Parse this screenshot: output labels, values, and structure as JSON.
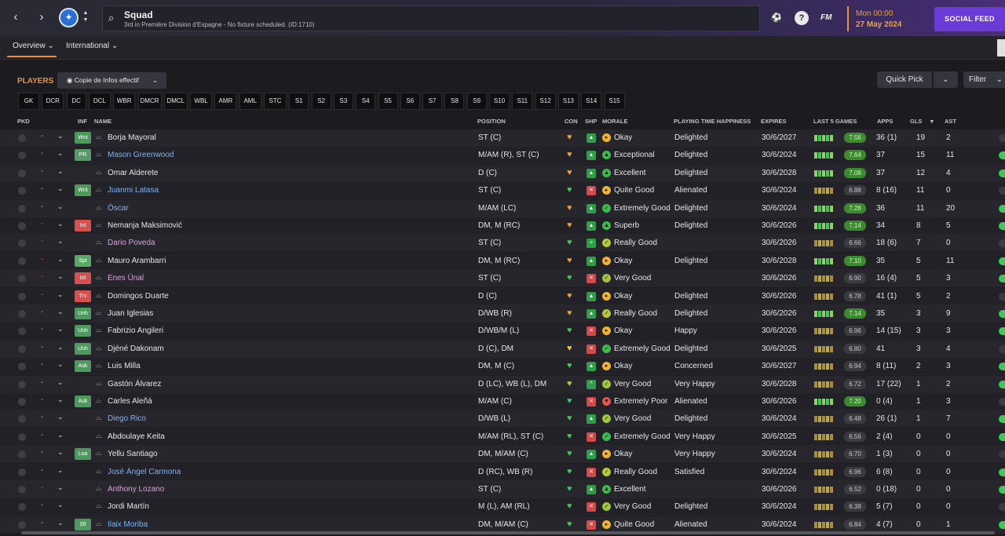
{
  "topbar": {
    "back_icon": "back-arrow-icon",
    "forward_icon": "forward-arrow-icon",
    "club_crest_icon": "getafe-crest-icon",
    "search": {
      "title": "Squad",
      "subtitle": "3rd in Première Division d'Espagne - No fixture scheduled. (ID:1710)"
    },
    "fm_logo": "FM",
    "date": {
      "time": "Mon 00:00",
      "date": "27 May 2024"
    },
    "social_feed": "SOCIAL FEED"
  },
  "tabs": [
    {
      "label": "Overview ⌄",
      "active": true
    },
    {
      "label": "International ⌄",
      "active": false
    }
  ],
  "toolbar": {
    "section_title": "PLAYERS",
    "view_label": "Copie de Infos effectif",
    "quick_pick": "Quick Pick",
    "filter": "Filter"
  },
  "position_filters": [
    "GK",
    "DCR",
    "DC",
    "DCL",
    "WBR",
    "DMCR",
    "DMCL",
    "WBL",
    "AMR",
    "AML",
    "STC",
    "S1",
    "S2",
    "S3",
    "S4",
    "S5",
    "S6",
    "S7",
    "S8",
    "S9",
    "S10",
    "S11",
    "S12",
    "S13",
    "S14",
    "S15"
  ],
  "columns": {
    "pkd": "PKD",
    "inf": "INF",
    "name": "NAME",
    "position": "POSITION",
    "con": "CON",
    "shp": "SHP",
    "morale": "MORALE",
    "pth": "PLAYING TIME HAPPINESS",
    "expires": "EXPIRES",
    "last5": "LAST 5 GAMES",
    "apps": "APPS",
    "gls": "GLS",
    "ast": "AST"
  },
  "colors": {
    "accent": "#e8942e",
    "social": "#6a3bd6",
    "loan_name": "#7fb4f0",
    "dev_name": "#d9a3d9"
  },
  "players": [
    {
      "inf": "Wnt",
      "name": "Borja Mayoral",
      "position": "ST (C)",
      "morale": "Okay",
      "pth": "Delighted",
      "expires": "30/6/2027",
      "rating": "7.56",
      "apps": "36 (1)",
      "gls": "19",
      "ast": "2"
    },
    {
      "inf": "PR",
      "name": "Mason Greenwood",
      "position": "M/AM (R), ST (C)",
      "morale": "Exceptional",
      "pth": "Delighted",
      "expires": "30/6/2024",
      "rating": "7.64",
      "apps": "37",
      "gls": "15",
      "ast": "11"
    },
    {
      "inf": "",
      "name": "Omar Alderete",
      "position": "D (C)",
      "morale": "Excellent",
      "pth": "Delighted",
      "expires": "30/6/2028",
      "rating": "7.08",
      "apps": "37",
      "gls": "12",
      "ast": "4"
    },
    {
      "inf": "Wnt",
      "name": "Juanmi Latasa",
      "position": "ST (C)",
      "morale": "Quite Good",
      "pth": "Alienated",
      "expires": "30/6/2024",
      "rating": "6.88",
      "apps": "8 (16)",
      "gls": "11",
      "ast": "0"
    },
    {
      "inf": "",
      "name": "Óscar",
      "position": "M/AM (LC)",
      "morale": "Extremely Good",
      "pth": "Delighted",
      "expires": "30/6/2024",
      "rating": "7.28",
      "apps": "36",
      "gls": "11",
      "ast": "20"
    },
    {
      "inf": "Int",
      "name": "Nemanja Maksimović",
      "position": "DM, M (RC)",
      "morale": "Superb",
      "pth": "Delighted",
      "expires": "30/6/2026",
      "rating": "7.14",
      "apps": "34",
      "gls": "8",
      "ast": "5"
    },
    {
      "inf": "",
      "name": "Dario Poveda",
      "position": "ST (C)",
      "morale": "Really Good",
      "pth": "",
      "expires": "30/6/2026",
      "rating": "6.66",
      "apps": "18 (6)",
      "gls": "7",
      "ast": "0"
    },
    {
      "inf": "Spt",
      "name": "Mauro Arambarri",
      "position": "DM, M (RC)",
      "morale": "Okay",
      "pth": "Delighted",
      "expires": "30/6/2028",
      "rating": "7.10",
      "apps": "35",
      "gls": "5",
      "ast": "11"
    },
    {
      "inf": "Int",
      "name": "Enes Ünal",
      "position": "ST (C)",
      "morale": "Very Good",
      "pth": "",
      "expires": "30/6/2026",
      "rating": "6.90",
      "apps": "16 (4)",
      "gls": "5",
      "ast": "3"
    },
    {
      "inf": "Trv",
      "name": "Domingos Duarte",
      "position": "D (C)",
      "morale": "Okay",
      "pth": "Delighted",
      "expires": "30/6/2026",
      "rating": "6.78",
      "apps": "41 (1)",
      "gls": "5",
      "ast": "2"
    },
    {
      "inf": "Unh",
      "name": "Juan Iglesias",
      "position": "D/WB (R)",
      "morale": "Really Good",
      "pth": "Delighted",
      "expires": "30/6/2026",
      "rating": "7.14",
      "apps": "35",
      "gls": "3",
      "ast": "9"
    },
    {
      "inf": "Unh",
      "name": "Fabrizio Angileri",
      "position": "D/WB/M (L)",
      "morale": "Okay",
      "pth": "Happy",
      "expires": "30/6/2026",
      "rating": "6.96",
      "apps": "14 (15)",
      "gls": "3",
      "ast": "3"
    },
    {
      "inf": "Unh",
      "name": "Djéné Dakonam",
      "position": "D (C), DM",
      "morale": "Extremely Good",
      "pth": "Delighted",
      "expires": "30/6/2025",
      "rating": "6.80",
      "apps": "41",
      "gls": "3",
      "ast": "4"
    },
    {
      "inf": "Ask",
      "name": "Luis Milla",
      "position": "DM, M (C)",
      "morale": "Okay",
      "pth": "Concerned",
      "expires": "30/6/2027",
      "rating": "6.94",
      "apps": "8 (11)",
      "gls": "2",
      "ast": "3"
    },
    {
      "inf": "",
      "name": "Gastón Álvarez",
      "position": "D (LC), WB (L), DM",
      "morale": "Very Good",
      "pth": "Very Happy",
      "expires": "30/6/2028",
      "rating": "6.72",
      "apps": "17 (22)",
      "gls": "1",
      "ast": "2"
    },
    {
      "inf": "Ask",
      "name": "Carles Aleñá",
      "position": "M/AM (C)",
      "morale": "Extremely Poor",
      "pth": "Alienated",
      "expires": "30/6/2026",
      "rating": "7.20",
      "apps": "0 (4)",
      "gls": "1",
      "ast": "3"
    },
    {
      "inf": "",
      "name": "Diego Rico",
      "position": "D/WB (L)",
      "morale": "Very Good",
      "pth": "Delighted",
      "expires": "30/6/2024",
      "rating": "6.48",
      "apps": "26 (1)",
      "gls": "1",
      "ast": "7"
    },
    {
      "inf": "",
      "name": "Abdoulaye Keita",
      "position": "M/AM (RL), ST (C)",
      "morale": "Extremely Good",
      "pth": "Very Happy",
      "expires": "30/6/2025",
      "rating": "6.56",
      "apps": "2 (4)",
      "gls": "0",
      "ast": "0"
    },
    {
      "inf": "Loa",
      "name": "Yellu Santiago",
      "position": "DM, M/AM (C)",
      "morale": "Okay",
      "pth": "Very Happy",
      "expires": "30/6/2024",
      "rating": "6.70",
      "apps": "1 (3)",
      "gls": "0",
      "ast": "0"
    },
    {
      "inf": "",
      "name": "José Ángel Carmona",
      "position": "D (RC), WB (R)",
      "morale": "Really Good",
      "pth": "Satisfied",
      "expires": "30/6/2024",
      "rating": "6.96",
      "apps": "6 (8)",
      "gls": "0",
      "ast": "0"
    },
    {
      "inf": "",
      "name": "Anthony Lozano",
      "position": "ST (C)",
      "morale": "Excellent",
      "pth": "",
      "expires": "30/6/2026",
      "rating": "6.52",
      "apps": "0 (18)",
      "gls": "0",
      "ast": "0"
    },
    {
      "inf": "",
      "name": "Jordi Martín",
      "position": "M (L), AM (RL)",
      "morale": "Very Good",
      "pth": "Delighted",
      "expires": "30/6/2024",
      "rating": "6.38",
      "apps": "5 (7)",
      "gls": "0",
      "ast": "0"
    },
    {
      "inf": "Slt",
      "name": "Ilaix Moriba",
      "position": "DM, M/AM (C)",
      "morale": "Quite Good",
      "pth": "Alienated",
      "expires": "30/6/2024",
      "rating": "6.84",
      "apps": "4 (7)",
      "gls": "0",
      "ast": "1"
    }
  ]
}
